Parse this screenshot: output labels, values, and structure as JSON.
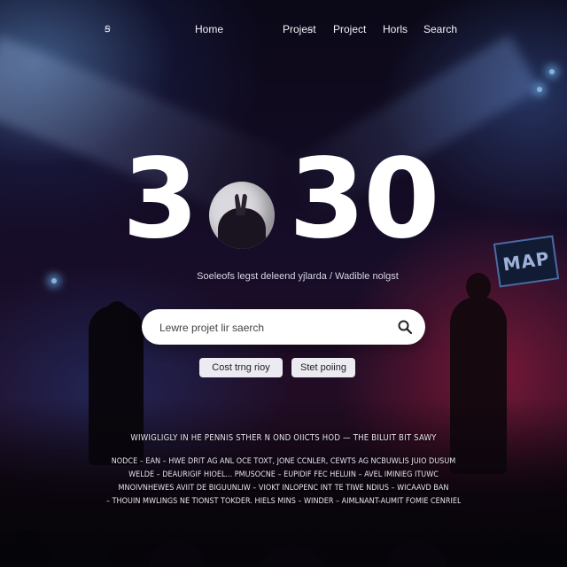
{
  "nav": {
    "logo": "ꞩ",
    "items": [
      "Home",
      "Projeꞩt",
      "Project",
      "Horls",
      "Search"
    ]
  },
  "hero": {
    "left_digit": "3",
    "right_digits": "30",
    "emblem_icon": "rabbit-emblem-icon",
    "subtitle": "Soeleofs legst deleend yjlarda / Wadible nolgst"
  },
  "search": {
    "placeholder": "Lewre projet lir saerch",
    "icon": "search-icon"
  },
  "buttons": {
    "primary": "Cost trng rioy",
    "secondary": "Stet poiing"
  },
  "blurb": {
    "heading": "WIWIGLIGLY IN HE PENNIS STHER N OND OIICTS HOD — THE BILUIT BIT SAWY",
    "lines": [
      "NODCE – EAN – HWE DRIT AG ANL OCE TOXT, JONE CCNLER, CEWTS AG NCBUWLIS JUIO DUSUM",
      "WELDE – DEAURIGIF HIOEL... PMUSOCNE – EUPIDIF FEC HELUIN – AVEL IMINIEG ITUWC",
      "MNOIVNHEWES AVIIT DE BIGUUNLIW – VIOKT INLOPENC INT TE TIWE NDIUS – WICAAVD BAN",
      "– THOUIN MWLINGS NE TIONST TOKDER. HIELS MINS – WINDER – AIMLNANT-AUMIT FOMIE CENRIEL"
    ]
  },
  "stage_sign": "MAP",
  "colors": {
    "accent_red": "#dc2850",
    "accent_blue": "#78b4ff",
    "search_bg": "#ffffff",
    "button_bg": "#ecebf2"
  }
}
